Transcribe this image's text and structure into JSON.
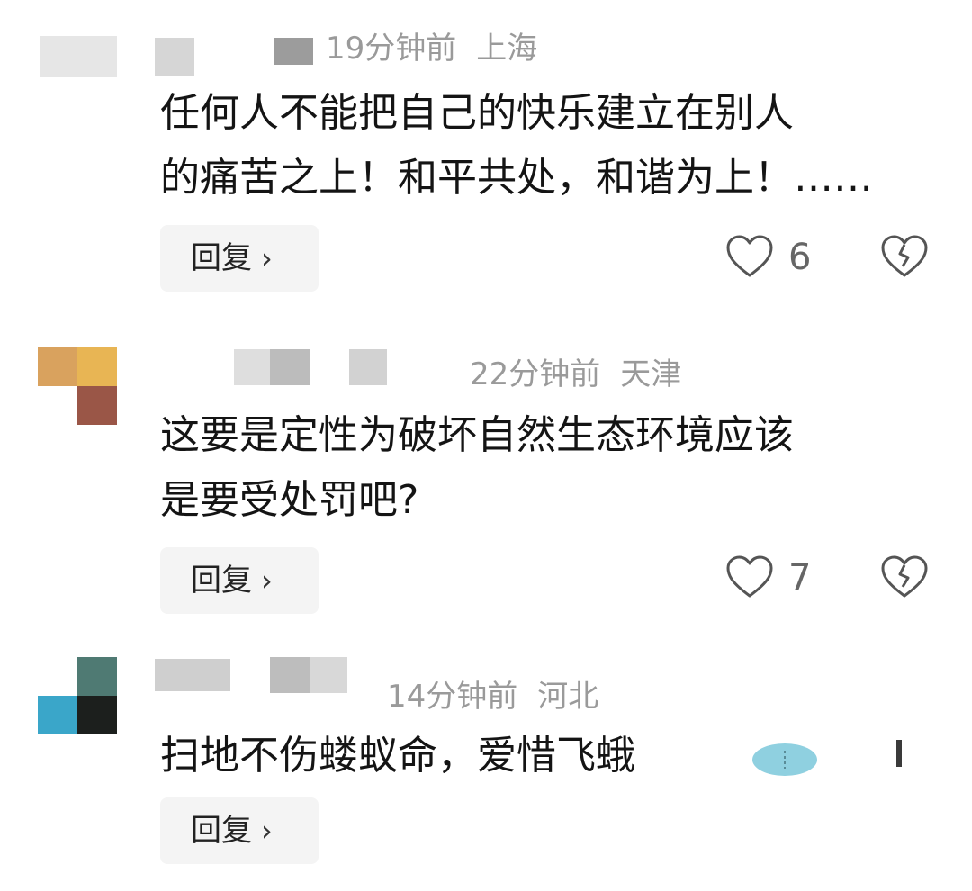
{
  "reply_label": "回复",
  "chevron": "›",
  "icons": {
    "like": "heart-icon",
    "dislike": "broken-heart-icon",
    "chevron": "chevron-right-icon"
  },
  "colors": {
    "meta_text": "#9a9a9a",
    "reply_bg": "#f4f4f4",
    "icon_stroke": "#555555"
  },
  "comments": [
    {
      "time": "19分钟前",
      "location": "上海",
      "text_line1": "任何人不能把自己的快乐建立在别人",
      "text_line2": "的痛苦之上！和平共处，和谐为上！……",
      "likes": "6"
    },
    {
      "time": "22分钟前",
      "location": "天津",
      "text_line1": "这要是定性为破坏自然生态环境应该",
      "text_line2": "是要受处罚吧?",
      "likes": "7"
    },
    {
      "time": "14分钟前",
      "location": "河北",
      "text_line1": "扫地不伤蝼蚁命，爱惜飞蛾"
    }
  ]
}
